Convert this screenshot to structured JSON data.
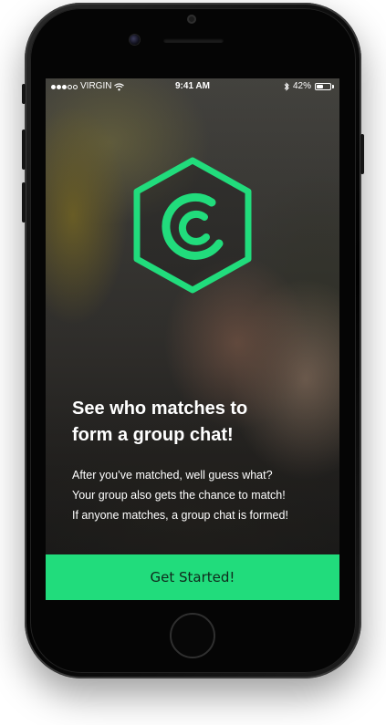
{
  "status_bar": {
    "carrier": "VIRGIN",
    "time": "9:41 AM",
    "battery": "42%",
    "signal_bars": 3,
    "signal_icon": "signal-dots-icon",
    "wifi_icon": "wifi-icon",
    "bluetooth_icon": "bluetooth-icon",
    "battery_level": 0.42
  },
  "logo": {
    "icon": "hexagon-c-logo-icon",
    "color": "#21dc7c"
  },
  "onboarding": {
    "headline_line1": "See who matches to",
    "headline_line2": "form a group chat!",
    "body_line1": "After you’ve matched, well guess what?",
    "body_line2": "Your group also gets the chance to match!",
    "body_line3": "If anyone matches, a group chat is formed!",
    "cta_label": "Get Started!",
    "cta_color": "#21dc7c"
  }
}
